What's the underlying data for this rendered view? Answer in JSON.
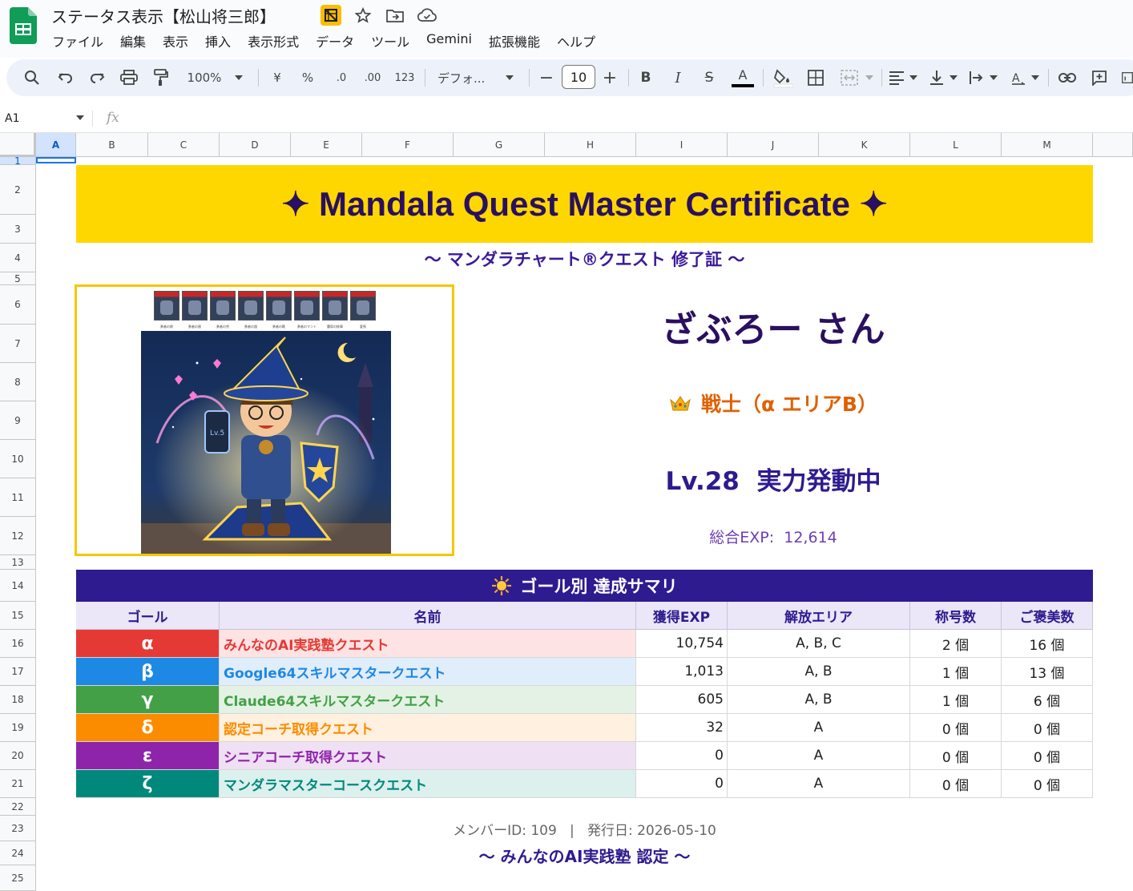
{
  "app": {
    "doc_title": "ステータス表示【松山将三郎】",
    "menu": [
      "ファイル",
      "編集",
      "表示",
      "挿入",
      "表示形式",
      "データ",
      "ツール",
      "Gemini",
      "拡張機能",
      "ヘルプ"
    ]
  },
  "toolbar": {
    "zoom": "100%",
    "currency": "¥",
    "percent": "%",
    "dec_decrease": ".0",
    "dec_increase": ".00",
    "number_format": "123",
    "font": "デフォ...",
    "font_size": "10",
    "bold": "B",
    "italic": "I",
    "strike": "S",
    "text_color": "A"
  },
  "formula_bar": {
    "cell_ref": "A1",
    "fx": "fx"
  },
  "grid": {
    "columns": [
      "A",
      "B",
      "C",
      "D",
      "E",
      "F",
      "G",
      "H",
      "I",
      "J",
      "K",
      "L",
      "M"
    ],
    "rows": [
      "1",
      "2",
      "3",
      "4",
      "5",
      "6",
      "7",
      "8",
      "9",
      "10",
      "11",
      "12",
      "13",
      "14",
      "15",
      "16",
      "17",
      "18",
      "19",
      "20",
      "21",
      "22",
      "23",
      "24",
      "25"
    ]
  },
  "certificate": {
    "title": "✦ Mandala Quest Master Certificate ✦",
    "subtitle": "〜 マンダラチャート®クエスト 修了証 〜",
    "player_name": "ざぶろー さん",
    "class_label": "戦士（α エリアB）",
    "level": "Lv.28  実力発動中",
    "exp_text": "総合EXP:  12,614",
    "avatar_text": "Lv.5",
    "items": [
      "勇者の剣",
      "勇者の盾",
      "勇者の兜",
      "勇者の鎧",
      "勇者の靴",
      "勇者のマント",
      "魔導の紋章",
      "愛馬"
    ]
  },
  "summary": {
    "title": "ゴール別 達成サマリ",
    "headers": [
      "ゴール",
      "名前",
      "獲得EXP",
      "解放エリア",
      "称号数",
      "ご褒美数"
    ],
    "rows": [
      {
        "code": "α",
        "name": "みんなのAI実践塾クエスト",
        "exp": "10,754",
        "area": "A, B, C",
        "titles": "2 個",
        "rewards": "16 個"
      },
      {
        "code": "β",
        "name": "Google64スキルマスタークエスト",
        "exp": "1,013",
        "area": "A, B",
        "titles": "1 個",
        "rewards": "13 個"
      },
      {
        "code": "γ",
        "name": "Claude64スキルマスタークエスト",
        "exp": "605",
        "area": "A, B",
        "titles": "1 個",
        "rewards": "6 個"
      },
      {
        "code": "δ",
        "name": "認定コーチ取得クエスト",
        "exp": "32",
        "area": "A",
        "titles": "0 個",
        "rewards": "0 個"
      },
      {
        "code": "ε",
        "name": "シニアコーチ取得クエスト",
        "exp": "0",
        "area": "A",
        "titles": "0 個",
        "rewards": "0 個"
      },
      {
        "code": "ζ",
        "name": "マンダラマスターコースクエスト",
        "exp": "0",
        "area": "A",
        "titles": "0 個",
        "rewards": "0 個"
      }
    ]
  },
  "footer": {
    "member_line": "メンバーID: 109   |   発行日: 2026-05-10",
    "certified_by": "〜 みんなのAI実践塾 認定 〜"
  },
  "colors": {
    "banner": "#ffd700",
    "navy": "#2d1b8f",
    "row_colors": [
      "#e53935",
      "#1e88e5",
      "#43a047",
      "#fb8c00",
      "#8e24aa",
      "#00897b"
    ],
    "row_bgs": [
      "#fde3e3",
      "#e0edfb",
      "#e3f2e4",
      "#fff0df",
      "#efe0f3",
      "#dcf0ee"
    ]
  }
}
